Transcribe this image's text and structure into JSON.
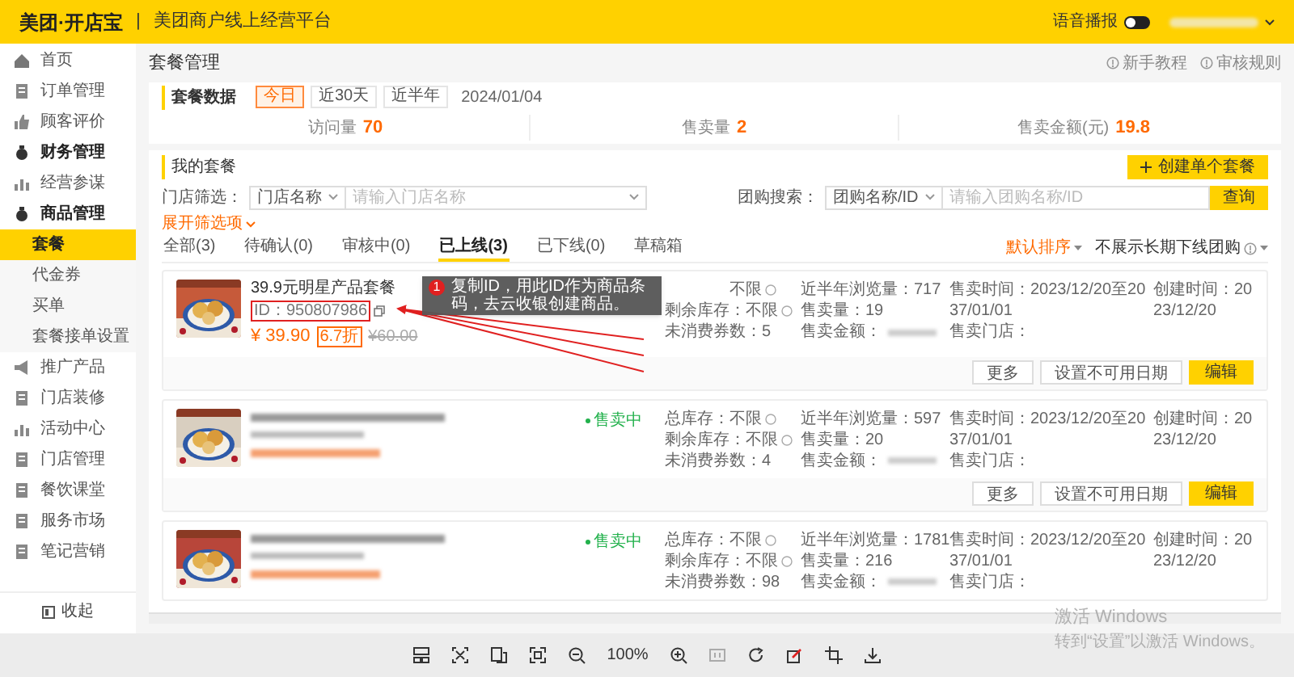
{
  "header": {
    "logo": "美团·开店宝",
    "divider": "|",
    "subtitle": "美团商户线上经营平台",
    "voice_label": "语音播报",
    "voice_on": false
  },
  "sidebar": {
    "items": [
      {
        "label": "首页",
        "bold": false
      },
      {
        "label": "订单管理",
        "bold": false
      },
      {
        "label": "顾客评价",
        "bold": false
      },
      {
        "label": "财务管理",
        "bold": true
      },
      {
        "label": "经营参谋",
        "bold": false
      },
      {
        "label": "商品管理",
        "bold": true,
        "children": [
          {
            "label": "套餐",
            "selected": true
          },
          {
            "label": "代金券",
            "selected": false
          },
          {
            "label": "买单",
            "selected": false
          },
          {
            "label": "套餐接单设置",
            "selected": false
          }
        ]
      },
      {
        "label": "推广产品",
        "bold": false
      },
      {
        "label": "门店装修",
        "bold": false
      },
      {
        "label": "活动中心",
        "bold": false
      },
      {
        "label": "门店管理",
        "bold": false
      },
      {
        "label": "餐饮课堂",
        "bold": false
      },
      {
        "label": "服务市场",
        "bold": false
      },
      {
        "label": "笔记营销",
        "bold": false
      }
    ],
    "collapse": "收起"
  },
  "page_title": "套餐管理",
  "help_links": [
    "新手教程",
    "审核规则"
  ],
  "stats_panel": {
    "title": "套餐数据",
    "ranges": [
      {
        "label": "今日",
        "selected": true
      },
      {
        "label": "近30天",
        "selected": false
      },
      {
        "label": "近半年",
        "selected": false
      }
    ],
    "date": "2024/01/04",
    "metrics": [
      {
        "label": "访问量",
        "value": "70"
      },
      {
        "label": "售卖量",
        "value": "2"
      },
      {
        "label": "售卖金额(元)",
        "value": "19.8"
      }
    ]
  },
  "packages_panel": {
    "title": "我的套餐",
    "create_button": "创建单个套餐",
    "store_filter": {
      "label": "门店筛选：",
      "select": "门店名称",
      "placeholder": "请输入门店名称"
    },
    "deal_search": {
      "label": "团购搜索：",
      "select": "团购名称/ID",
      "placeholder": "请输入团购名称/ID",
      "button": "查询"
    },
    "expand_filters": "展开筛选项",
    "tabs": [
      {
        "label": "全部(3)",
        "selected": false
      },
      {
        "label": "待确认(0)",
        "selected": false
      },
      {
        "label": "审核中(0)",
        "selected": false
      },
      {
        "label": "已上线(3)",
        "selected": true
      },
      {
        "label": "已下线(0)",
        "selected": false
      },
      {
        "label": "草稿箱",
        "selected": false
      }
    ],
    "sort": "默认排序",
    "hide_offline": "不展示长期下线团购",
    "cards": [
      {
        "redacted": false,
        "title": "39.9元明星产品套餐",
        "id": "ID：950807986",
        "price": "¥ 39.90",
        "discount": "6.7折",
        "original_price": "¥60.00",
        "stock": [
          "不限",
          "剩余库存：不限",
          "未消费券数：5"
        ],
        "views": [
          "近半年浏览量：717",
          "售卖量：19",
          "售卖金额："
        ],
        "times": [
          "售卖时间：2023/12/20至2037/01/01",
          "售卖门店："
        ],
        "created": "创建时间：2023/12/20",
        "buttons": [
          "更多",
          "设置不可用日期",
          "编辑"
        ],
        "tooltip": {
          "badge": "1",
          "text": "复制ID，用此ID作为商品条码，去云收银创建商品。"
        }
      },
      {
        "redacted": true,
        "status": "售卖中",
        "stock": [
          "总库存：不限",
          "剩余库存：不限",
          "未消费券数：4"
        ],
        "views": [
          "近半年浏览量：597",
          "售卖量：20",
          "售卖金额："
        ],
        "times": [
          "售卖时间：2023/12/20至2037/01/01",
          "售卖门店："
        ],
        "created": "创建时间：2023/12/20",
        "buttons": [
          "更多",
          "设置不可用日期",
          "编辑"
        ]
      },
      {
        "redacted": true,
        "status": "售卖中",
        "stock": [
          "总库存：不限",
          "剩余库存：不限",
          "未消费券数：98"
        ],
        "views": [
          "近半年浏览量：1781",
          "售卖量：216",
          "售卖金额："
        ],
        "times": [
          "售卖时间：2023/12/20至2037/01/01",
          "售卖门店："
        ],
        "created": "创建时间：2023/12/20"
      }
    ]
  },
  "viewer_toolbar": {
    "zoom": "100%"
  },
  "os_notice": {
    "title": "激活 Windows",
    "text": "转到“设置”以激活 Windows。"
  }
}
